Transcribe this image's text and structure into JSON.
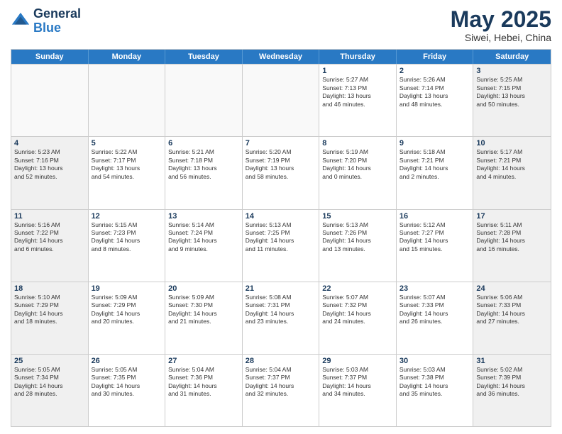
{
  "header": {
    "logo_general": "General",
    "logo_blue": "Blue",
    "month_year": "May 2025",
    "location": "Siwei, Hebei, China"
  },
  "days_of_week": [
    "Sunday",
    "Monday",
    "Tuesday",
    "Wednesday",
    "Thursday",
    "Friday",
    "Saturday"
  ],
  "rows": [
    [
      {
        "day": "",
        "empty": true
      },
      {
        "day": "",
        "empty": true
      },
      {
        "day": "",
        "empty": true
      },
      {
        "day": "",
        "empty": true
      },
      {
        "day": "1",
        "lines": [
          "Sunrise: 5:27 AM",
          "Sunset: 7:13 PM",
          "Daylight: 13 hours",
          "and 46 minutes."
        ]
      },
      {
        "day": "2",
        "lines": [
          "Sunrise: 5:26 AM",
          "Sunset: 7:14 PM",
          "Daylight: 13 hours",
          "and 48 minutes."
        ]
      },
      {
        "day": "3",
        "shaded": true,
        "lines": [
          "Sunrise: 5:25 AM",
          "Sunset: 7:15 PM",
          "Daylight: 13 hours",
          "and 50 minutes."
        ]
      }
    ],
    [
      {
        "day": "4",
        "shaded": true,
        "lines": [
          "Sunrise: 5:23 AM",
          "Sunset: 7:16 PM",
          "Daylight: 13 hours",
          "and 52 minutes."
        ]
      },
      {
        "day": "5",
        "lines": [
          "Sunrise: 5:22 AM",
          "Sunset: 7:17 PM",
          "Daylight: 13 hours",
          "and 54 minutes."
        ]
      },
      {
        "day": "6",
        "lines": [
          "Sunrise: 5:21 AM",
          "Sunset: 7:18 PM",
          "Daylight: 13 hours",
          "and 56 minutes."
        ]
      },
      {
        "day": "7",
        "lines": [
          "Sunrise: 5:20 AM",
          "Sunset: 7:19 PM",
          "Daylight: 13 hours",
          "and 58 minutes."
        ]
      },
      {
        "day": "8",
        "lines": [
          "Sunrise: 5:19 AM",
          "Sunset: 7:20 PM",
          "Daylight: 14 hours",
          "and 0 minutes."
        ]
      },
      {
        "day": "9",
        "lines": [
          "Sunrise: 5:18 AM",
          "Sunset: 7:21 PM",
          "Daylight: 14 hours",
          "and 2 minutes."
        ]
      },
      {
        "day": "10",
        "shaded": true,
        "lines": [
          "Sunrise: 5:17 AM",
          "Sunset: 7:21 PM",
          "Daylight: 14 hours",
          "and 4 minutes."
        ]
      }
    ],
    [
      {
        "day": "11",
        "shaded": true,
        "lines": [
          "Sunrise: 5:16 AM",
          "Sunset: 7:22 PM",
          "Daylight: 14 hours",
          "and 6 minutes."
        ]
      },
      {
        "day": "12",
        "lines": [
          "Sunrise: 5:15 AM",
          "Sunset: 7:23 PM",
          "Daylight: 14 hours",
          "and 8 minutes."
        ]
      },
      {
        "day": "13",
        "lines": [
          "Sunrise: 5:14 AM",
          "Sunset: 7:24 PM",
          "Daylight: 14 hours",
          "and 9 minutes."
        ]
      },
      {
        "day": "14",
        "lines": [
          "Sunrise: 5:13 AM",
          "Sunset: 7:25 PM",
          "Daylight: 14 hours",
          "and 11 minutes."
        ]
      },
      {
        "day": "15",
        "lines": [
          "Sunrise: 5:13 AM",
          "Sunset: 7:26 PM",
          "Daylight: 14 hours",
          "and 13 minutes."
        ]
      },
      {
        "day": "16",
        "lines": [
          "Sunrise: 5:12 AM",
          "Sunset: 7:27 PM",
          "Daylight: 14 hours",
          "and 15 minutes."
        ]
      },
      {
        "day": "17",
        "shaded": true,
        "lines": [
          "Sunrise: 5:11 AM",
          "Sunset: 7:28 PM",
          "Daylight: 14 hours",
          "and 16 minutes."
        ]
      }
    ],
    [
      {
        "day": "18",
        "shaded": true,
        "lines": [
          "Sunrise: 5:10 AM",
          "Sunset: 7:29 PM",
          "Daylight: 14 hours",
          "and 18 minutes."
        ]
      },
      {
        "day": "19",
        "lines": [
          "Sunrise: 5:09 AM",
          "Sunset: 7:29 PM",
          "Daylight: 14 hours",
          "and 20 minutes."
        ]
      },
      {
        "day": "20",
        "lines": [
          "Sunrise: 5:09 AM",
          "Sunset: 7:30 PM",
          "Daylight: 14 hours",
          "and 21 minutes."
        ]
      },
      {
        "day": "21",
        "lines": [
          "Sunrise: 5:08 AM",
          "Sunset: 7:31 PM",
          "Daylight: 14 hours",
          "and 23 minutes."
        ]
      },
      {
        "day": "22",
        "lines": [
          "Sunrise: 5:07 AM",
          "Sunset: 7:32 PM",
          "Daylight: 14 hours",
          "and 24 minutes."
        ]
      },
      {
        "day": "23",
        "lines": [
          "Sunrise: 5:07 AM",
          "Sunset: 7:33 PM",
          "Daylight: 14 hours",
          "and 26 minutes."
        ]
      },
      {
        "day": "24",
        "shaded": true,
        "lines": [
          "Sunrise: 5:06 AM",
          "Sunset: 7:33 PM",
          "Daylight: 14 hours",
          "and 27 minutes."
        ]
      }
    ],
    [
      {
        "day": "25",
        "shaded": true,
        "lines": [
          "Sunrise: 5:05 AM",
          "Sunset: 7:34 PM",
          "Daylight: 14 hours",
          "and 28 minutes."
        ]
      },
      {
        "day": "26",
        "lines": [
          "Sunrise: 5:05 AM",
          "Sunset: 7:35 PM",
          "Daylight: 14 hours",
          "and 30 minutes."
        ]
      },
      {
        "day": "27",
        "lines": [
          "Sunrise: 5:04 AM",
          "Sunset: 7:36 PM",
          "Daylight: 14 hours",
          "and 31 minutes."
        ]
      },
      {
        "day": "28",
        "lines": [
          "Sunrise: 5:04 AM",
          "Sunset: 7:37 PM",
          "Daylight: 14 hours",
          "and 32 minutes."
        ]
      },
      {
        "day": "29",
        "lines": [
          "Sunrise: 5:03 AM",
          "Sunset: 7:37 PM",
          "Daylight: 14 hours",
          "and 34 minutes."
        ]
      },
      {
        "day": "30",
        "lines": [
          "Sunrise: 5:03 AM",
          "Sunset: 7:38 PM",
          "Daylight: 14 hours",
          "and 35 minutes."
        ]
      },
      {
        "day": "31",
        "shaded": true,
        "lines": [
          "Sunrise: 5:02 AM",
          "Sunset: 7:39 PM",
          "Daylight: 14 hours",
          "and 36 minutes."
        ]
      }
    ]
  ]
}
